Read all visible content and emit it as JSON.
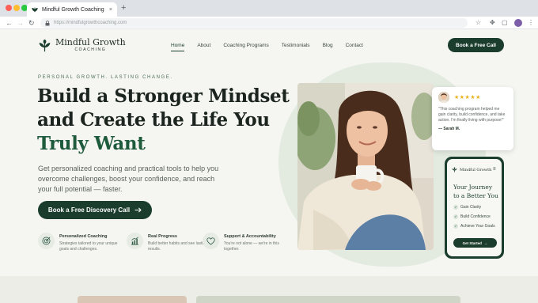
{
  "browser": {
    "tab_title": "Mindful Growth Coaching",
    "tab_close": "×",
    "new_tab": "+",
    "url": "https://mindfulgrowthcoaching.com",
    "icons": [
      "back-icon",
      "forward-icon",
      "reload-icon",
      "lock-icon",
      "star-icon",
      "extensions-icon",
      "sidepanel-icon",
      "profile-icon",
      "menu-icon"
    ]
  },
  "header": {
    "logo_name": "Mindful Growth",
    "logo_sub": "COACHING",
    "nav": [
      {
        "label": "Home",
        "active": true
      },
      {
        "label": "About"
      },
      {
        "label": "Coaching Programs"
      },
      {
        "label": "Testimonials"
      },
      {
        "label": "Blog"
      },
      {
        "label": "Contact"
      }
    ],
    "cta": "Book a Free Call"
  },
  "hero": {
    "eyebrow": "PERSONAL GROWTH. LASTING CHANGE.",
    "headline_line1": "Build a Stronger Mindset",
    "headline_line2": "and Create the Life You",
    "headline_accent": "Truly Want",
    "subtext": "Get personalized coaching and practical tools to help you overcome challenges, boost your confidence, and reach your full potential — faster.",
    "cta": "Book a Free Discovery Call"
  },
  "features": [
    {
      "icon": "target-icon",
      "title": "Personalized Coaching",
      "desc": "Strategies tailored to your unique goals and challenges."
    },
    {
      "icon": "growth-chart-icon",
      "title": "Real Progress",
      "desc": "Build better habits and see lasting results."
    },
    {
      "icon": "heart-icon",
      "title": "Support & Accountability",
      "desc": "You're not alone — we're in this together."
    }
  ],
  "testimonial": {
    "stars": "★★★★★",
    "rating": 5,
    "text": "\"This coaching program helped me gain clarity, build confidence, and take action. I'm finally living with purpose!\"",
    "author": "— Sarah M."
  },
  "phone": {
    "brand": "Mindful Growth",
    "title_line1": "Your Journey",
    "title_line2": "to a Better You",
    "checklist": [
      "Gain Clarity",
      "Build Confidence",
      "Achieve Your Goals"
    ],
    "cta": "Get Started"
  },
  "colors": {
    "brand_dark_green": "#1b3d2e",
    "accent_green": "#1e5a3c",
    "star_gold": "#e9b21d",
    "page_bg": "#f5f6f1"
  }
}
